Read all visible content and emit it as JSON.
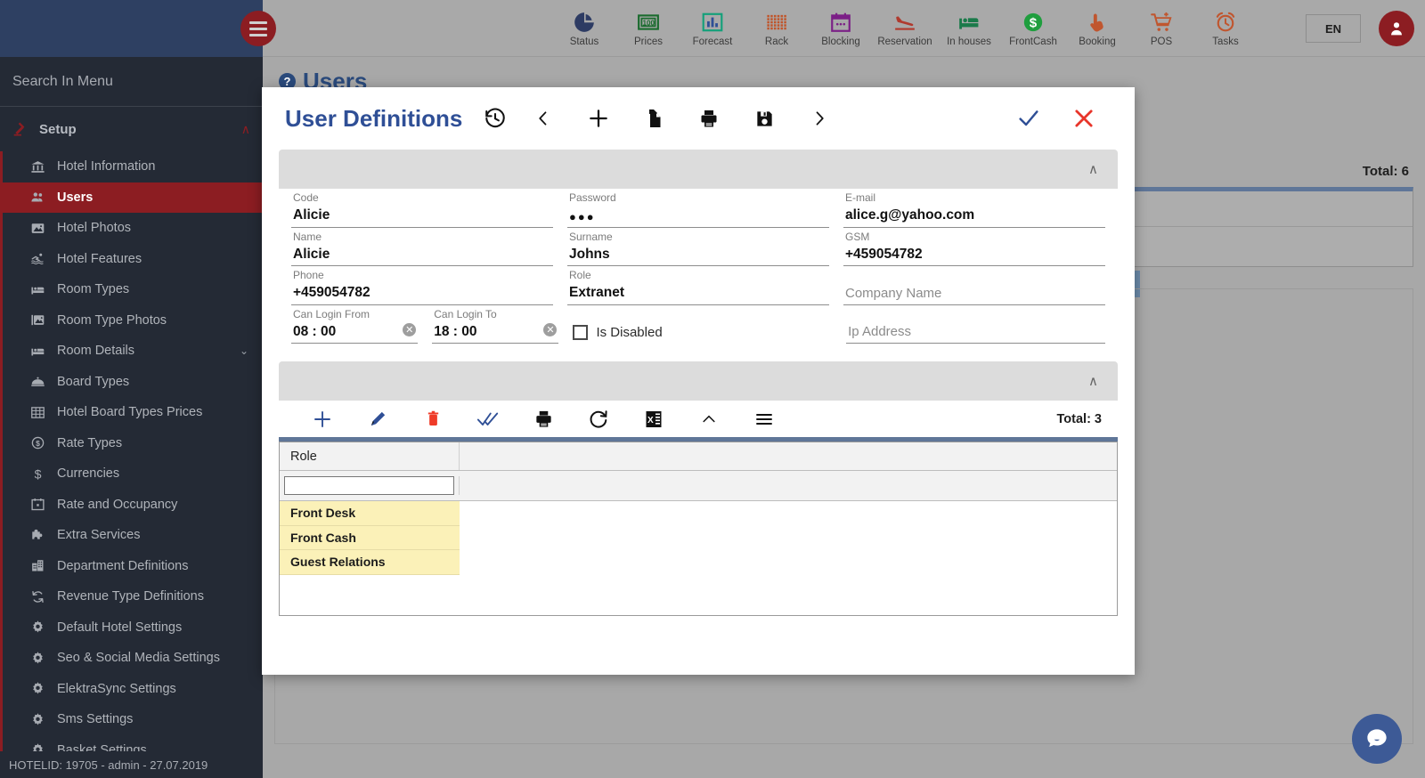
{
  "topbar": {
    "menu_icon": "hamburger-icon",
    "nav_items": [
      {
        "label": "Status",
        "icon": "pie-chart-icon"
      },
      {
        "label": "Prices",
        "icon": "money-100-icon"
      },
      {
        "label": "Forecast",
        "icon": "bar-chart-icon"
      },
      {
        "label": "Rack",
        "icon": "grid-dots-icon"
      },
      {
        "label": "Blocking",
        "icon": "calendar-icon"
      },
      {
        "label": "Reservation",
        "icon": "plane-landing-icon"
      },
      {
        "label": "In houses",
        "icon": "bed-icon"
      },
      {
        "label": "FrontCash",
        "icon": "dollar-circle-icon"
      },
      {
        "label": "Booking",
        "icon": "hand-click-icon"
      },
      {
        "label": "POS",
        "icon": "shopping-cart-icon"
      },
      {
        "label": "Tasks",
        "icon": "alarm-clock-icon"
      }
    ],
    "language": "EN",
    "avatar_icon": "user-avatar-icon"
  },
  "sidebar": {
    "search_placeholder": "Search In Menu",
    "search_value": "",
    "group": {
      "label": "Setup",
      "icon": "setup-tools-icon",
      "chevron": "∧"
    },
    "items": [
      {
        "label": "Hotel Information",
        "icon": "bank-icon",
        "active": false,
        "expandable": false
      },
      {
        "label": "Users",
        "icon": "people-icon",
        "active": true,
        "expandable": false
      },
      {
        "label": "Hotel Photos",
        "icon": "photo-icon",
        "active": false,
        "expandable": false
      },
      {
        "label": "Hotel Features",
        "icon": "swimmer-icon",
        "active": false,
        "expandable": false
      },
      {
        "label": "Room Types",
        "icon": "bed-icon",
        "active": false,
        "expandable": false
      },
      {
        "label": "Room Type Photos",
        "icon": "photo-stack-icon",
        "active": false,
        "expandable": false
      },
      {
        "label": "Room Details",
        "icon": "bed-icon",
        "active": false,
        "expandable": true
      },
      {
        "label": "Board Types",
        "icon": "room-service-icon",
        "active": false,
        "expandable": false
      },
      {
        "label": "Hotel Board Types Prices",
        "icon": "table-grid-icon",
        "active": false,
        "expandable": false
      },
      {
        "label": "Rate Types",
        "icon": "dollar-circle-icon",
        "active": false,
        "expandable": false
      },
      {
        "label": "Currencies",
        "icon": "dollar-sign-icon",
        "active": false,
        "expandable": false
      },
      {
        "label": "Rate and Occupancy",
        "icon": "calendar-icon",
        "active": false,
        "expandable": false
      },
      {
        "label": "Extra Services",
        "icon": "puzzle-icon",
        "active": false,
        "expandable": false
      },
      {
        "label": "Department Definitions",
        "icon": "building-icon",
        "active": false,
        "expandable": false
      },
      {
        "label": "Revenue Type Definitions",
        "icon": "refresh-cycle-icon",
        "active": false,
        "expandable": false
      },
      {
        "label": "Default Hotel Settings",
        "icon": "gear-icon",
        "active": false,
        "expandable": false
      },
      {
        "label": "Seo & Social Media Settings",
        "icon": "gear-icon",
        "active": false,
        "expandable": false
      },
      {
        "label": "ElektraSync Settings",
        "icon": "gear-icon",
        "active": false,
        "expandable": false
      },
      {
        "label": "Sms Settings",
        "icon": "gear-icon",
        "active": false,
        "expandable": false
      },
      {
        "label": "Basket Settings",
        "icon": "gear-icon",
        "active": false,
        "expandable": false
      }
    ],
    "footer": "HOTELID: 19705 - admin - 27.07.2019"
  },
  "page": {
    "title": "Users",
    "help_icon": "question-mark-icon",
    "total": "Total: 6"
  },
  "modal": {
    "title": "User Definitions",
    "header_buttons": [
      {
        "name": "history-icon",
        "glyph": "history"
      },
      {
        "name": "previous-icon",
        "glyph": "chevron-left"
      },
      {
        "name": "add-icon",
        "glyph": "plus"
      },
      {
        "name": "copy-icon",
        "glyph": "copy"
      },
      {
        "name": "print-icon",
        "glyph": "printer"
      },
      {
        "name": "save-icon",
        "glyph": "floppy"
      },
      {
        "name": "next-icon",
        "glyph": "chevron-right"
      }
    ],
    "confirm_icon": "check-icon",
    "close_icon": "close-icon",
    "panel_chevron": "∧",
    "fields": {
      "code": {
        "label": "Code",
        "value": "Alicie"
      },
      "password": {
        "label": "Password",
        "value": "●●●"
      },
      "email": {
        "label": "E-mail",
        "value": "alice.g@yahoo.com"
      },
      "name": {
        "label": "Name",
        "value": "Alicie"
      },
      "surname": {
        "label": "Surname",
        "value": "Johns"
      },
      "gsm": {
        "label": "GSM",
        "value": "+459054782"
      },
      "phone": {
        "label": "Phone",
        "value": "+459054782"
      },
      "role": {
        "label": "Role",
        "value": "Extranet"
      },
      "company": {
        "label": "",
        "value": "",
        "placeholder": "Company Name"
      },
      "login_from": {
        "label": "Can Login From",
        "value": "08 : 00"
      },
      "login_to": {
        "label": "Can Login To",
        "value": "18 : 00"
      },
      "is_disabled": {
        "label": "Is Disabled",
        "checked": false
      },
      "ip_address": {
        "label": "",
        "value": "",
        "placeholder": "Ip Address"
      }
    },
    "grid": {
      "toolbar": [
        {
          "name": "add-row-icon",
          "glyph": "plus"
        },
        {
          "name": "edit-row-icon",
          "glyph": "pencil"
        },
        {
          "name": "delete-row-icon",
          "glyph": "trash"
        },
        {
          "name": "select-all-icon",
          "glyph": "double-check"
        },
        {
          "name": "print-grid-icon",
          "glyph": "printer"
        },
        {
          "name": "refresh-icon",
          "glyph": "refresh"
        },
        {
          "name": "export-excel-icon",
          "glyph": "excel"
        },
        {
          "name": "collapse-icon",
          "glyph": "caret-up"
        },
        {
          "name": "menu-icon",
          "glyph": "hamburger"
        }
      ],
      "total": "Total: 3",
      "columns": [
        "Role"
      ],
      "filter_value": "",
      "rows": [
        {
          "role": "Front Desk"
        },
        {
          "role": "Front Cash"
        },
        {
          "role": "Guest Relations"
        }
      ]
    }
  },
  "chat": {
    "icon": "chat-bubble-icon"
  },
  "colors": {
    "sidebar_bg": "#242a35",
    "accent_red": "#8c1d22",
    "modal_title_blue": "#2f4f96",
    "grid_header_blue": "#5f7698",
    "row_yellow": "#fbf1b8",
    "close_red": "#e8352a",
    "topbar_bg": "#a9a9a9"
  }
}
